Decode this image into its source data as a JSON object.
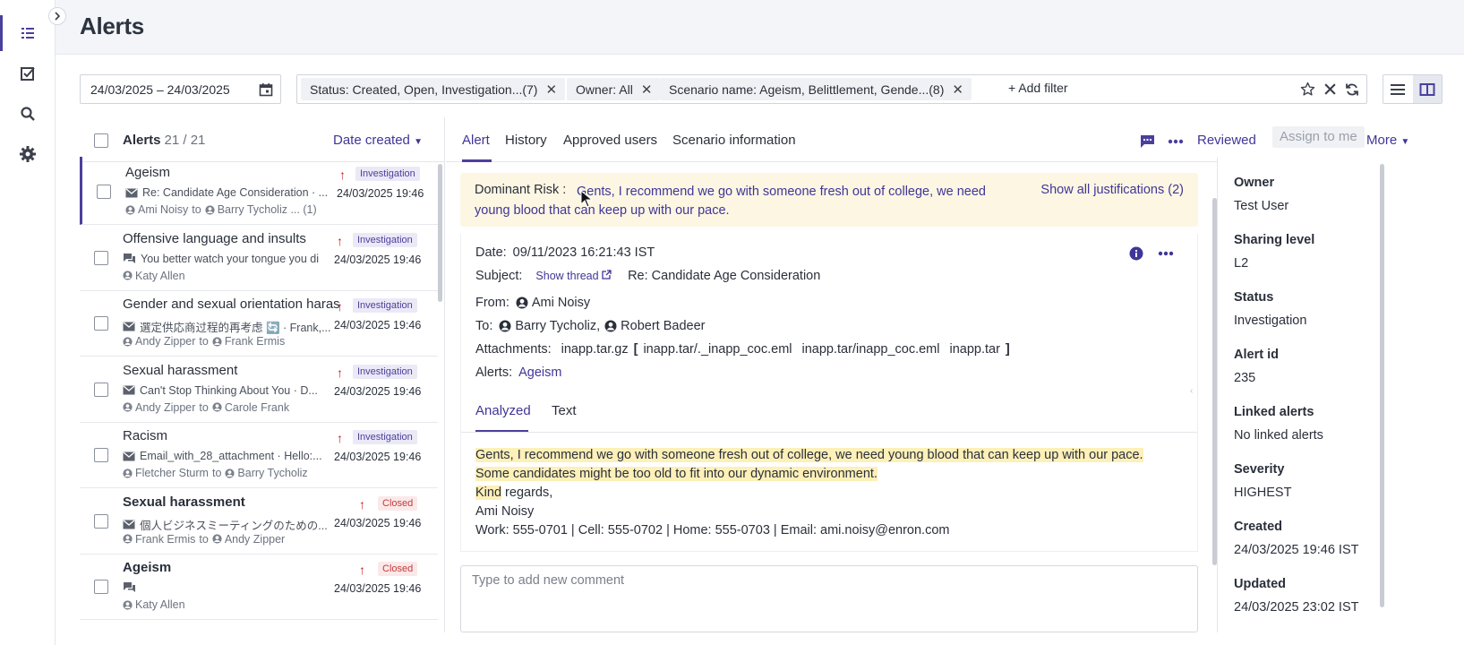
{
  "page": {
    "title": "Alerts"
  },
  "nav": {
    "icons": [
      "list-icon",
      "checkbox-icon",
      "search-icon",
      "gear-icon"
    ]
  },
  "date_range": "24/03/2025 – 24/03/2025",
  "filters": {
    "chips": [
      "Status: Created, Open, Investigation...(7)",
      "Owner: All",
      "Scenario name: Ageism, Belittlement, Gende...(8)"
    ],
    "add_label": "+ Add filter"
  },
  "list": {
    "title": "Alerts",
    "count": "21 / 21",
    "sort_label": "Date created",
    "rows": [
      {
        "title": "Ageism",
        "status": "Investigation",
        "subject": "Re: Candidate Age Consideration · ...",
        "date": "24/03/2025 19:46",
        "from": "Ami Noisy",
        "to": "Barry Tycholiz ... (1)"
      },
      {
        "title": "Offensive language and insults",
        "status": "Investigation",
        "subject": "You better watch your tongue you di",
        "date": "24/03/2025 19:46",
        "from": "Katy Allen",
        "to": ""
      },
      {
        "title": "Gender and sexual orientation haras",
        "status": "Investigation",
        "subject": "選定供応商过程的再考虑 🔄 · Frank,...",
        "date": "24/03/2025 19:46",
        "from": "Andy Zipper",
        "to": "Frank Ermis"
      },
      {
        "title": "Sexual harassment",
        "status": "Investigation",
        "subject": "Can't Stop Thinking About You · D...",
        "date": "24/03/2025 19:46",
        "from": "Andy Zipper",
        "to": "Carole Frank"
      },
      {
        "title": "Racism",
        "status": "Investigation",
        "subject": "Email_with_28_attachment · Hello:...",
        "date": "24/03/2025 19:46",
        "from": "Fletcher Sturm",
        "to": "Barry Tycholiz"
      },
      {
        "title": "Sexual harassment",
        "status": "Closed",
        "subject": "個人ビジネスミーティングのための...",
        "date": "24/03/2025 19:46",
        "from": "Frank Ermis",
        "to": "Andy Zipper"
      },
      {
        "title": "Ageism",
        "status": "Closed",
        "subject": "",
        "date": "24/03/2025 19:46",
        "from": "Katy Allen",
        "to": ""
      }
    ],
    "connector": "to"
  },
  "detail": {
    "tabs": [
      "Alert",
      "History",
      "Approved users",
      "Scenario information"
    ],
    "actions": {
      "reviewed": "Reviewed",
      "assign": "Assign to me",
      "more": "More"
    },
    "risk": {
      "label": "Dominant Risk :",
      "text": "Gents, I recommend we go with someone fresh out of college, we need young blood that can keep up with our pace.",
      "justifications": "Show all justifications (2)"
    },
    "email": {
      "date_label": "Date:",
      "date": "09/11/2023 16:21:43 IST",
      "subject_label": "Subject:",
      "show_thread": "Show thread",
      "subject": "Re: Candidate Age Consideration",
      "from_label": "From:",
      "from": "Ami Noisy",
      "to_label": "To:",
      "to": [
        "Barry Tycholiz,",
        "Robert Badeer"
      ],
      "attachments_label": "Attachments:",
      "attachments": [
        "inapp.tar.gz",
        "[",
        "inapp.tar/._inapp_coc.eml",
        "inapp.tar/inapp_coc.eml",
        "inapp.tar",
        "]"
      ],
      "alerts_label": "Alerts:",
      "alerts": "Ageism"
    },
    "subtabs": [
      "Analyzed",
      "Text"
    ],
    "body": {
      "highlight1": "Gents, I recommend we go with someone fresh out of college, we need young blood that can keep up with our pace. Some candidates might be too old to fit into our dynamic environment.",
      "highlight2": "Kind",
      "line2_rest": " regards,",
      "line3": "Ami Noisy",
      "line4": "Work: 555-0701 | Cell: 555-0702 | Home: 555-0703 | Email: ami.noisy@enron.com"
    },
    "comment_placeholder": "Type to add new comment"
  },
  "properties": [
    {
      "label": "Owner",
      "value": "Test User"
    },
    {
      "label": "Sharing level",
      "value": "L2"
    },
    {
      "label": "Status",
      "value": "Investigation"
    },
    {
      "label": "Alert id",
      "value": "235"
    },
    {
      "label": "Linked alerts",
      "value": "No linked alerts"
    },
    {
      "label": "Severity",
      "value": "HIGHEST"
    },
    {
      "label": "Created",
      "value": "24/03/2025 19:46 IST"
    },
    {
      "label": "Updated",
      "value": "24/03/2025 23:02 IST"
    }
  ],
  "colors": {
    "accent": "#3f3697",
    "risk_bg": "#fdf6e3",
    "highlight": "#fdf0b8",
    "alert_arrow": "#c81e1e"
  }
}
